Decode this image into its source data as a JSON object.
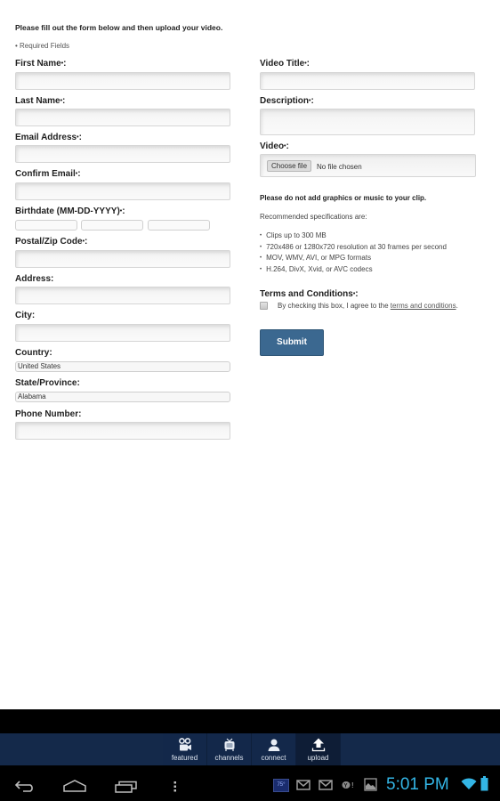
{
  "form": {
    "intro": "Please fill out the form below and then upload your video.",
    "required_note": "• Required Fields",
    "required_marker": "•",
    "left_fields": {
      "first_name": {
        "label": "First Name",
        "required": true,
        "value": ""
      },
      "last_name": {
        "label": "Last Name",
        "required": true,
        "value": ""
      },
      "email": {
        "label": "Email Address",
        "required": true,
        "value": ""
      },
      "confirm_email": {
        "label": "Confirm Email",
        "required": true,
        "value": ""
      },
      "birthdate": {
        "label": "Birthdate (MM-DD-YYYY)",
        "required": true,
        "month": "",
        "day": "",
        "year": ""
      },
      "postal": {
        "label": "Postal/Zip Code",
        "required": true,
        "value": ""
      },
      "address": {
        "label": "Address",
        "required": false,
        "value": ""
      },
      "city": {
        "label": "City",
        "required": false,
        "value": ""
      },
      "country": {
        "label": "Country",
        "required": false,
        "value": "United States"
      },
      "state": {
        "label": "State/Province",
        "required": false,
        "value": "Alabama"
      },
      "phone": {
        "label": "Phone Number",
        "required": false,
        "value": ""
      }
    },
    "right_fields": {
      "video_title": {
        "label": "Video Title",
        "required": true,
        "value": ""
      },
      "description": {
        "label": "Description",
        "required": true,
        "value": ""
      },
      "video": {
        "label": "Video",
        "required": true,
        "button": "Choose file",
        "status": "No file chosen"
      }
    },
    "notice": "Please do not add graphics or music to your clip.",
    "spec_heading": "Recommended specifications are:",
    "specs": [
      "Clips up to 300 MB",
      "720x486 or 1280x720 resolution at 30 frames per second",
      "MOV, WMV, AVI, or MPG formats",
      "H.264, DivX, Xvid, or AVC codecs"
    ],
    "terms": {
      "label": "Terms and Conditions",
      "required": true,
      "checked": false,
      "text_prefix": "By checking this box, I agree to the ",
      "link_text": "terms and conditions",
      "text_suffix": "."
    },
    "submit_label": "Submit"
  },
  "app_tabs": [
    {
      "label": "featured",
      "icon": "film-camera-icon",
      "active": false
    },
    {
      "label": "channels",
      "icon": "tv-icon",
      "active": false
    },
    {
      "label": "connect",
      "icon": "person-icon",
      "active": false
    },
    {
      "label": "upload",
      "icon": "upload-icon",
      "active": true
    }
  ],
  "system_bar": {
    "weather": "75°",
    "time": "5:01 PM",
    "notifications": [
      "weather-icon",
      "gmail-icon",
      "gmail-icon",
      "yahoo-messenger-icon",
      "gallery-icon"
    ],
    "status": [
      "wifi-icon",
      "battery-icon"
    ]
  },
  "colors": {
    "submit": "#3b6890",
    "appbar": "#14294a",
    "clock": "#33b5e5"
  }
}
